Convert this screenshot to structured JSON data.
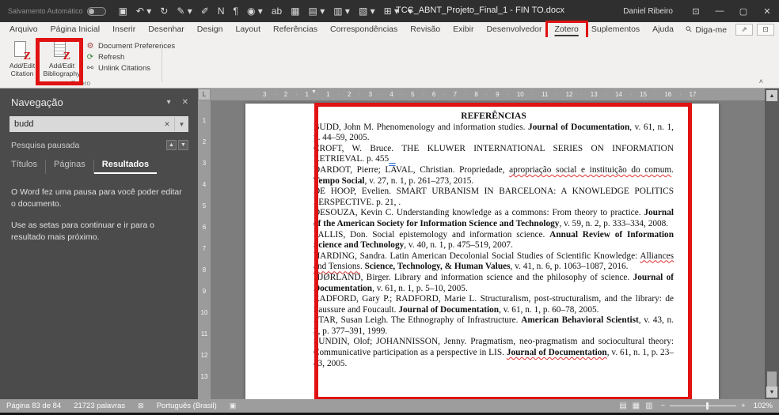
{
  "titlebar": {
    "autosave_label": "Salvamento Automático",
    "autosave_state": "off",
    "qat": [
      {
        "name": "save-icon",
        "glyph": "▣"
      },
      {
        "name": "undo-icon",
        "glyph": "↶ ▾"
      },
      {
        "name": "redo-icon",
        "glyph": "↻"
      },
      {
        "name": "editor-icon",
        "glyph": "✎ ▾"
      },
      {
        "name": "format-painter-icon",
        "glyph": "✐"
      },
      {
        "name": "bold-icon",
        "glyph": "N"
      },
      {
        "name": "paragraph-marks-icon",
        "glyph": "¶"
      },
      {
        "name": "read-aloud-icon",
        "glyph": "◉ ▾"
      },
      {
        "name": "translate-icon",
        "glyph": "ab"
      },
      {
        "name": "picture-icon",
        "glyph": "▦"
      },
      {
        "name": "new-document-icon",
        "glyph": "▤ ▾"
      },
      {
        "name": "open-document-icon",
        "glyph": "▥ ▾"
      },
      {
        "name": "paste-icon",
        "glyph": "▧ ▾"
      },
      {
        "name": "table-icon",
        "glyph": "⊞ ▾"
      },
      {
        "name": "qat-overflow-icon",
        "glyph": "▾"
      }
    ],
    "document_title": "TCC_ABNT_Projeto_Final_1 - FIN TO.docx",
    "user_name": "Daniel Ribeiro",
    "window": {
      "ribbon_options": "⊡",
      "minimize": "—",
      "restore": "▢",
      "close": "✕"
    }
  },
  "ribbon": {
    "tabs": [
      "Arquivo",
      "Página Inicial",
      "Inserir",
      "Desenhar",
      "Design",
      "Layout",
      "Referências",
      "Correspondências",
      "Revisão",
      "Exibir",
      "Desenvolvedor",
      "Zotero",
      "Suplementos",
      "Ajuda"
    ],
    "active_tab": "Zotero",
    "tellme_label": "Diga-me",
    "share_icon": "⇗",
    "comments_icon": "⊡",
    "zotero_group": {
      "label": "Zotero",
      "zotero_icon_letter": "Z",
      "big_buttons": [
        {
          "label": "Add/Edit Citation",
          "highlighted": false
        },
        {
          "label": "Add/Edit Bibliography",
          "highlighted": true
        }
      ],
      "small_buttons": [
        {
          "label": "Document Preferences",
          "icon": "⚙",
          "icon_name": "gear-icon"
        },
        {
          "label": "Refresh",
          "icon": "⟳",
          "icon_name": "refresh-icon"
        },
        {
          "label": "Unlink Citations",
          "icon": "⚯",
          "icon_name": "unlink-icon"
        }
      ]
    },
    "collapse_icon": "˄"
  },
  "nav_pane": {
    "title": "Navegação",
    "options_icon": "▾",
    "close_icon": "✕",
    "search_value": "budd",
    "search_clear_icon": "✕",
    "search_dropdown_icon": "▾",
    "status": "Pesquisa pausada",
    "prev_icon": "▲",
    "next_icon": "▼",
    "tabs": [
      "Títulos",
      "Páginas",
      "Resultados"
    ],
    "active_tab": "Resultados",
    "message1": "O Word fez uma pausa para você poder editar o documento.",
    "message2": "Use as setas para continuar e ir para o resultado mais próximo."
  },
  "rulers": {
    "tab_selector": "L",
    "horizontal": [
      "3",
      "2",
      "1",
      "1",
      "2",
      "3",
      "4",
      "5",
      "6",
      "7",
      "8",
      "9",
      "10",
      "11",
      "12",
      "13",
      "14",
      "15",
      "16",
      "17"
    ],
    "vertical": [
      "1",
      "2",
      "3",
      "4",
      "5",
      "6",
      "7",
      "8",
      "9",
      "10",
      "11",
      "12",
      "13"
    ],
    "margin_marker": "▼"
  },
  "document": {
    "heading": "REFERÊNCIAS",
    "references": [
      [
        {
          "t": "BUDD, John M. Phenomenology and information studies. "
        },
        {
          "t": "Journal of Documentation",
          "b": 1
        },
        {
          "t": ", v. 61, n. 1, p. 44–59, 2005."
        }
      ],
      [
        {
          "t": "CROFT, W. Bruce. THE KLUWER INTERNATIONAL SERIES ON INFORMATION RETRIEVAL. p. 455"
        },
        {
          "t": "   ",
          "u": "blue"
        }
      ],
      [
        {
          "t": "DARDOT, Pierre; LAVAL, Christian. Propriedade, "
        },
        {
          "t": "apropriação social e instituição do comum",
          "u": "red"
        },
        {
          "t": ". "
        },
        {
          "t": "Tempo Social",
          "b": 1
        },
        {
          "t": ", v. 27, n. 1, p. 261–273, 2015."
        }
      ],
      [
        {
          "t": "DE HOOP, Evelien. SMART URBANISM IN BARCELONA: A KNOWLEDGE POLITICS PERSPECTIVE. p. 21, ."
        }
      ],
      [
        {
          "t": "DESOUZA, Kevin C. Understanding knowledge as a commons: From theory to practice. "
        },
        {
          "t": "Journal of the American Society for Information Science and Technology",
          "b": 1
        },
        {
          "t": ", v. 59, n. 2, p. 333–334, 2008."
        }
      ],
      [
        {
          "t": "FALLIS, Don. Social epistemology and information science. "
        },
        {
          "t": "Annual Review of Information Science and Technology",
          "b": 1
        },
        {
          "t": ", v. 40, n. 1, p. 475–519, 2007."
        }
      ],
      [
        {
          "t": "HARDING, Sandra. Latin American Decolonial Social Studies of Scientific Knowledge: "
        },
        {
          "t": "Alliances and Tensions",
          "u": "red"
        },
        {
          "t": ". "
        },
        {
          "t": "Science, Technology, & Human Values",
          "b": 1
        },
        {
          "t": ", v. 41, n. 6, p. 1063–1087, 2016."
        }
      ],
      [
        {
          "t": "HJØRLAND, Birger. Library and information science and the philosophy of science. "
        },
        {
          "t": "Journal of Documentation",
          "b": 1
        },
        {
          "t": ", v. 61, n. 1, p. 5–10, 2005."
        }
      ],
      [
        {
          "t": "RADFORD, Gary P.; RADFORD, Marie L. Structuralism, post-structuralism, and the library: de Saussure and Foucault. "
        },
        {
          "t": "Journal of Documentation",
          "b": 1
        },
        {
          "t": ", v. 61, n. 1, p. 60–78, 2005."
        }
      ],
      [
        {
          "t": "STAR, Susan Leigh. The Ethnography of Infrastructure. "
        },
        {
          "t": "American Behavioral Scientist",
          "b": 1
        },
        {
          "t": ", v. 43, n. 3, p. 377–391, 1999."
        }
      ],
      [
        {
          "t": "SUNDIN, Olof; JOHANNISSON, Jenny. Pragmatism, neo-pragmatism and sociocultural theory: Communicative participation as a perspective in LIS. "
        },
        {
          "t": "Journal of Documentation",
          "b": 1,
          "u": "red"
        },
        {
          "t": ", v. 61, n. 1, p. 23–43, 2005."
        }
      ]
    ]
  },
  "scrollbar": {
    "up_icon": "▲",
    "down_icon": "▼"
  },
  "statusbar": {
    "page": "Página 83 de 84",
    "words": "21723 palavras",
    "proofing_icon": "⊠",
    "language": "Português (Brasil)",
    "macro_icon": "▣",
    "view_icons": [
      "▤",
      "▦",
      "▥"
    ],
    "zoom_out_icon": "−",
    "zoom_in_icon": "+",
    "zoom_level": "102%"
  },
  "colors": {
    "annotation_red": "#e01212",
    "page_white": "#ffffff",
    "pane_gray": "#4b4b4b"
  }
}
